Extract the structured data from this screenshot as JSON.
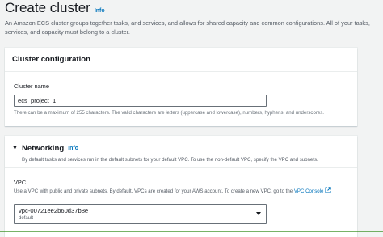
{
  "header": {
    "title": "Create cluster",
    "info": "Info",
    "description": "An Amazon ECS cluster groups together tasks, and services, and allows for shared capacity and common configurations. All of your tasks, services, and capacity must belong to a cluster."
  },
  "cluster_configuration": {
    "title": "Cluster configuration",
    "name_label": "Cluster name",
    "name_value": "ecs_project_1",
    "name_hint": "There can be a maximum of 255 characters. The valid characters are letters (uppercase and lowercase), numbers, hyphens, and underscores."
  },
  "networking": {
    "title": "Networking",
    "info": "Info",
    "description": "By default tasks and services run in the default subnets for your default VPC. To use the non-default VPC, specify the VPC and subnets.",
    "vpc_label": "VPC",
    "vpc_description": "Use a VPC with public and private subnets. By default, VPCs are created for your AWS account. To create a new VPC, go to the",
    "vpc_console_link": "VPC Console",
    "vpc_selected": "vpc-00721ee2b60d37b8e",
    "vpc_selected_sub": "default",
    "caret_icon": "caret-down-icon",
    "external_icon": "external-link-icon"
  }
}
